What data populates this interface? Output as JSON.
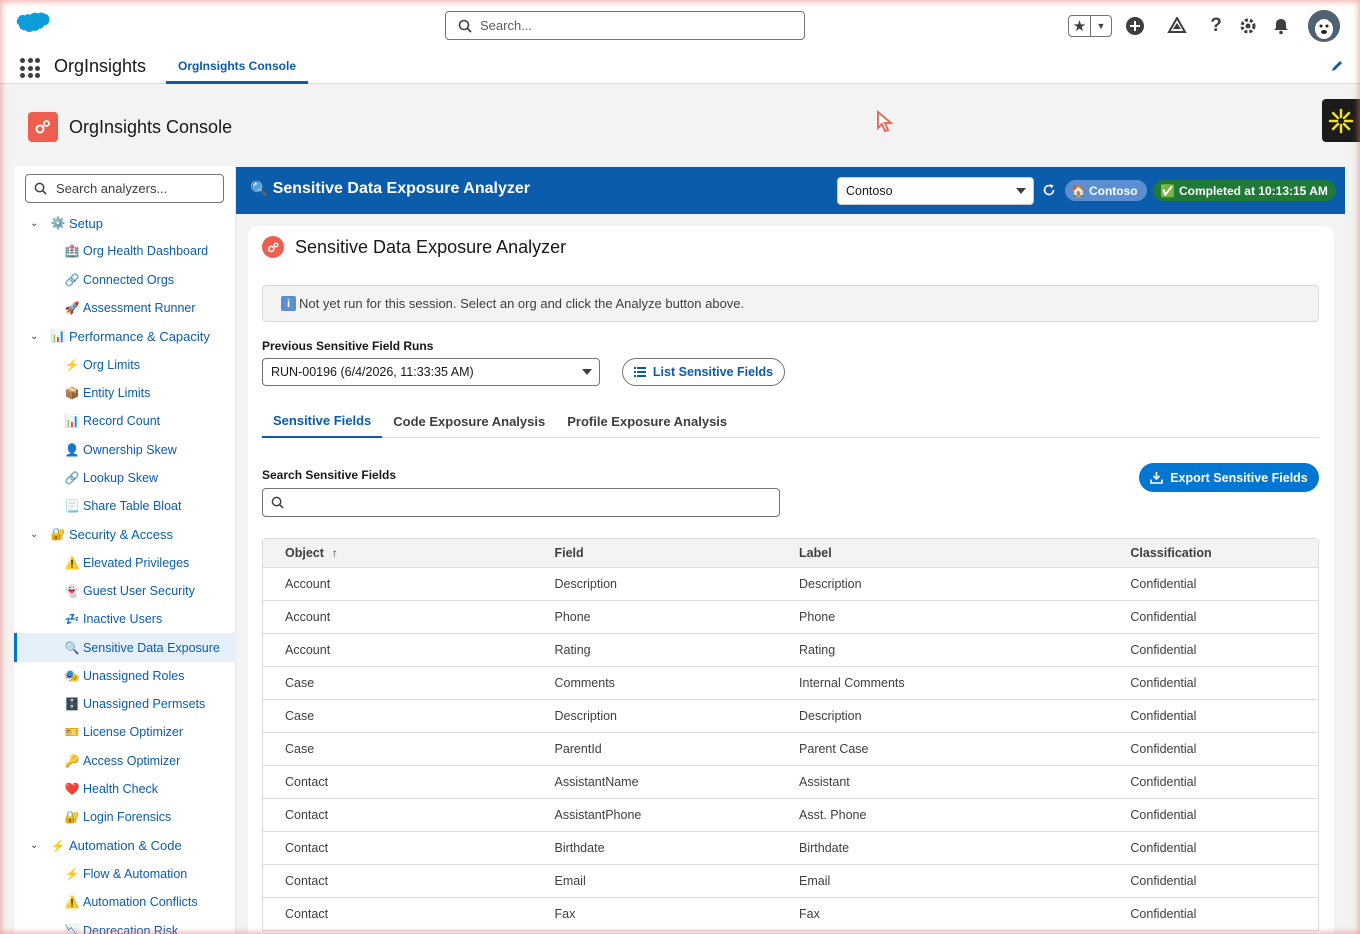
{
  "global_header": {
    "search_placeholder": "Search...",
    "icons": [
      "favorites-star-icon",
      "add-icon",
      "trailhead-icon",
      "help-icon",
      "setup-gear-icon",
      "notifications-bell-icon",
      "avatar"
    ]
  },
  "app_nav": {
    "app_name": "OrgInsights",
    "tabs": [
      {
        "label": "OrgInsights Console",
        "active": true
      }
    ]
  },
  "page": {
    "title": "OrgInsights Console"
  },
  "sidebar": {
    "search_placeholder": "Search analyzers...",
    "groups": [
      {
        "label": "Setup",
        "emoji": "⚙️",
        "items": [
          {
            "label": "Org Health Dashboard",
            "emoji": "🏥"
          },
          {
            "label": "Connected Orgs",
            "emoji": "🔗"
          },
          {
            "label": "Assessment Runner",
            "emoji": "🚀"
          }
        ]
      },
      {
        "label": "Performance & Capacity",
        "emoji": "📊",
        "items": [
          {
            "label": "Org Limits",
            "emoji": "⚡"
          },
          {
            "label": "Entity Limits",
            "emoji": "📦"
          },
          {
            "label": "Record Count",
            "emoji": "📊"
          },
          {
            "label": "Ownership Skew",
            "emoji": "👤"
          },
          {
            "label": "Lookup Skew",
            "emoji": "🔗"
          },
          {
            "label": "Share Table Bloat",
            "emoji": "📃"
          }
        ]
      },
      {
        "label": "Security & Access",
        "emoji": "🔐",
        "items": [
          {
            "label": "Elevated Privileges",
            "emoji": "⚠️"
          },
          {
            "label": "Guest User Security",
            "emoji": "👻"
          },
          {
            "label": "Inactive Users",
            "emoji": "💤"
          },
          {
            "label": "Sensitive Data Exposure",
            "emoji": "🔍",
            "active": true
          },
          {
            "label": "Unassigned Roles",
            "emoji": "🎭"
          },
          {
            "label": "Unassigned Permsets",
            "emoji": "🗄️"
          },
          {
            "label": "License Optimizer",
            "emoji": "🎫"
          },
          {
            "label": "Access Optimizer",
            "emoji": "🔑"
          },
          {
            "label": "Health Check",
            "emoji": "❤️"
          },
          {
            "label": "Login Forensics",
            "emoji": "🔐"
          }
        ]
      },
      {
        "label": "Automation & Code",
        "emoji": "⚡",
        "items": [
          {
            "label": "Flow & Automation",
            "emoji": "⚡"
          },
          {
            "label": "Automation Conflicts",
            "emoji": "⚠️"
          },
          {
            "label": "Deprecation Risk",
            "emoji": "📉"
          }
        ]
      }
    ]
  },
  "banner": {
    "title": "Sensitive Data Exposure Analyzer",
    "org_select_value": "Contoso",
    "org_badge": "Contoso",
    "status": "Completed at 10:13:15 AM",
    "colors": {
      "banner": "#0b5cab",
      "status": "#1f7a3a"
    }
  },
  "card": {
    "title": "Sensitive Data Exposure Analyzer",
    "notice": "Not yet run for this session. Select an org and click the Analyze button above.",
    "prev_runs_label": "Previous Sensitive Field Runs",
    "prev_runs_value": "RUN-00196 (6/4/2026, 11:33:35 AM)",
    "list_button": "List Sensitive Fields",
    "tabs": [
      {
        "label": "Sensitive Fields",
        "active": true
      },
      {
        "label": "Code Exposure Analysis",
        "active": false
      },
      {
        "label": "Profile Exposure Analysis",
        "active": false
      }
    ],
    "search_label": "Search Sensitive Fields",
    "search_value": "",
    "export_button": "Export Sensitive Fields"
  },
  "table": {
    "columns": [
      "Object",
      "Field",
      "Label",
      "Classification"
    ],
    "sort": {
      "column": "Object",
      "direction": "asc"
    },
    "rows": [
      [
        "Account",
        "Description",
        "Description",
        "Confidential"
      ],
      [
        "Account",
        "Phone",
        "Phone",
        "Confidential"
      ],
      [
        "Account",
        "Rating",
        "Rating",
        "Confidential"
      ],
      [
        "Case",
        "Comments",
        "Internal Comments",
        "Confidential"
      ],
      [
        "Case",
        "Description",
        "Description",
        "Confidential"
      ],
      [
        "Case",
        "ParentId",
        "Parent Case",
        "Confidential"
      ],
      [
        "Contact",
        "AssistantName",
        "Assistant",
        "Confidential"
      ],
      [
        "Contact",
        "AssistantPhone",
        "Asst. Phone",
        "Confidential"
      ],
      [
        "Contact",
        "Birthdate",
        "Birthdate",
        "Confidential"
      ],
      [
        "Contact",
        "Email",
        "Email",
        "Confidential"
      ],
      [
        "Contact",
        "Fax",
        "Fax",
        "Confidential"
      ]
    ]
  }
}
